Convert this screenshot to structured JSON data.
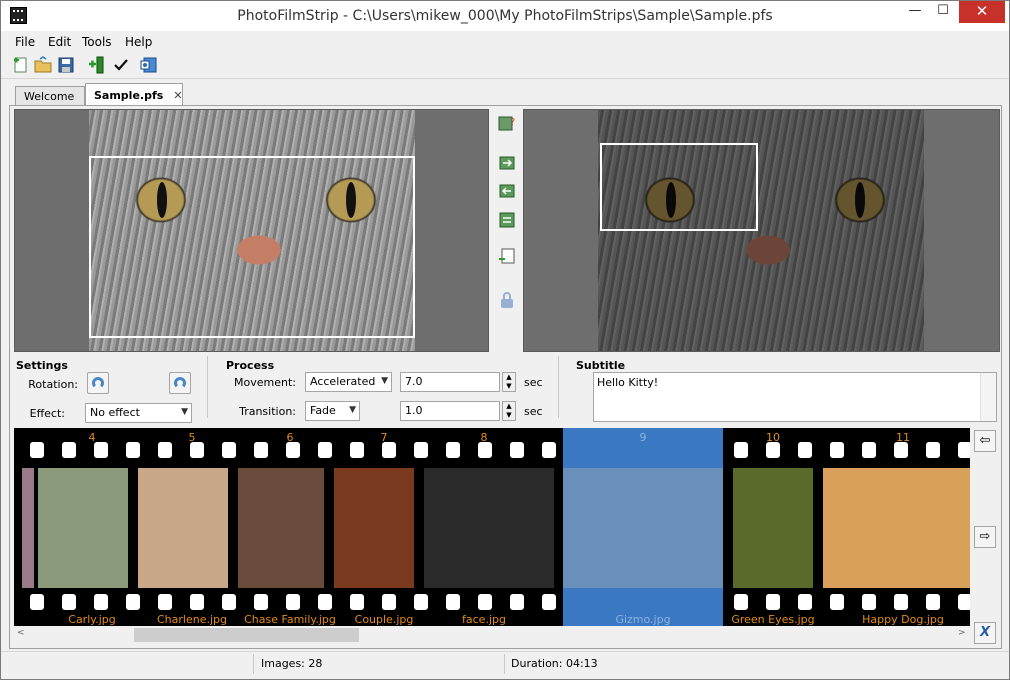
{
  "window": {
    "title": "PhotoFilmStrip - C:\\Users\\mikew_000\\My PhotoFilmStrips\\Sample\\Sample.pfs",
    "minimize": "—",
    "maximize": "☐",
    "close": "✕"
  },
  "menu": {
    "file": "File",
    "edit": "Edit",
    "tools": "Tools",
    "help": "Help"
  },
  "toolbar": {
    "icons": [
      "new-project-icon",
      "open-project-icon",
      "save-icon",
      "import-pictures-icon",
      "check-icon",
      "render-icon"
    ]
  },
  "tabs": [
    {
      "label": "Welcome"
    },
    {
      "label": "Sample.pfs",
      "close": "✕"
    }
  ],
  "settings": {
    "title": "Settings",
    "rotation_label": "Rotation:",
    "effect_label": "Effect:",
    "effect_value": "No effect"
  },
  "process": {
    "title": "Process",
    "movement_label": "Movement:",
    "movement_value": "Accelerated",
    "movement_duration": "7.0",
    "movement_unit": "sec",
    "transition_label": "Transition:",
    "transition_value": "Fade",
    "transition_duration": "1.0",
    "transition_unit": "sec"
  },
  "subtitle": {
    "title": "Subtitle",
    "text": "Hello Kitty!"
  },
  "filmstrip": {
    "frames": [
      {
        "number": "4",
        "name": "Carly.jpg",
        "color": "#8a9a7a"
      },
      {
        "number": "5",
        "name": "Charlene.jpg",
        "color": "#c9a88a"
      },
      {
        "number": "6",
        "name": "Chase Family.jpg",
        "color": "#6a4a3a"
      },
      {
        "number": "7",
        "name": "Couple.jpg",
        "color": "#7a3a20"
      },
      {
        "number": "8",
        "name": "face.jpg",
        "color": "#2a2a2a"
      },
      {
        "number": "9",
        "name": "Gizmo.jpg",
        "color": "#6a8fb8",
        "selected": true
      },
      {
        "number": "10",
        "name": "Green Eyes.jpg",
        "color": "#5a6a2a"
      },
      {
        "number": "11",
        "name": "Happy Dog.jpg",
        "color": "#d9a05a"
      }
    ]
  },
  "sidebar": {
    "left_arrow": "⇦",
    "right_arrow": "⇨",
    "remove": "X"
  },
  "status": {
    "images": "Images: 28",
    "duration": "Duration: 04:13"
  }
}
